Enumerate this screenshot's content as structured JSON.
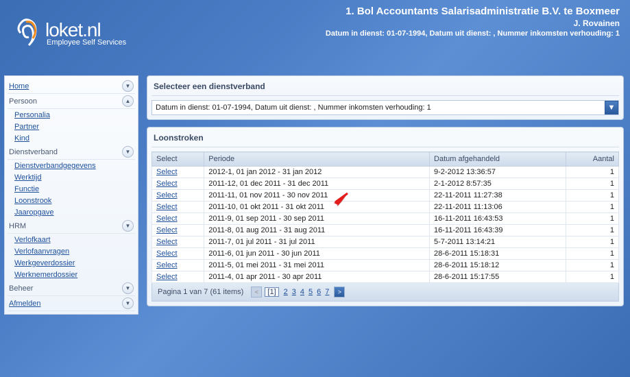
{
  "header": {
    "company": "1. Bol Accountants Salarisadministratie B.V. te Boxmeer",
    "user": "J. Rovainen",
    "detail": "Datum in dienst: 01-07-1994, Datum uit dienst: , Nummer inkomsten verhouding: 1"
  },
  "logo": {
    "name": "loket.nl",
    "tagline": "Employee Self Services"
  },
  "sidebar": {
    "groups": [
      {
        "label": "Home",
        "chev": "down",
        "items": []
      },
      {
        "label": "Persoon",
        "chev": "up",
        "items": [
          "Personalia",
          "Partner",
          "Kind"
        ]
      },
      {
        "label": "Dienstverband",
        "chev": "down",
        "items": [
          "Dienstverbandgegevens",
          "Werktijd",
          "Functie",
          "Loonstrook",
          "Jaaropgave"
        ]
      },
      {
        "label": "HRM",
        "chev": "down",
        "items": [
          "Verlofkaart",
          "Verlofaanvragen",
          "Werkgeverdossier",
          "Werknemerdossier"
        ]
      },
      {
        "label": "Beheer",
        "chev": "down",
        "items": []
      },
      {
        "label": "Afmelden",
        "chev": "down",
        "items": []
      }
    ]
  },
  "panels": {
    "selectTitle": "Selecteer een dienstverband",
    "combo": "Datum in dienst: 01-07-1994, Datum uit dienst: , Nummer inkomsten verhouding: 1",
    "gridTitle": "Loonstroken",
    "columns": [
      "Select",
      "Periode",
      "Datum afgehandeld",
      "Aantal"
    ],
    "selectLabel": "Select",
    "rows": [
      {
        "periode": "2012-1, 01 jan 2012 - 31 jan 2012",
        "datum": "9-2-2012 13:36:57",
        "aantal": "1"
      },
      {
        "periode": "2011-12, 01 dec 2011 - 31 dec 2011",
        "datum": "2-1-2012 8:57:35",
        "aantal": "1"
      },
      {
        "periode": "2011-11, 01 nov 2011 - 30 nov 2011",
        "datum": "22-11-2011 11:27:38",
        "aantal": "1"
      },
      {
        "periode": "2011-10, 01 okt 2011 - 31 okt 2011",
        "datum": "22-11-2011 11:13:06",
        "aantal": "1"
      },
      {
        "periode": "2011-9, 01 sep 2011 - 30 sep 2011",
        "datum": "16-11-2011 16:43:53",
        "aantal": "1"
      },
      {
        "periode": "2011-8, 01 aug 2011 - 31 aug 2011",
        "datum": "16-11-2011 16:43:39",
        "aantal": "1"
      },
      {
        "periode": "2011-7, 01 jul 2011 - 31 jul 2011",
        "datum": "5-7-2011 13:14:21",
        "aantal": "1"
      },
      {
        "periode": "2011-6, 01 jun 2011 - 30 jun 2011",
        "datum": "28-6-2011 15:18:31",
        "aantal": "1"
      },
      {
        "periode": "2011-5, 01 mei 2011 - 31 mei 2011",
        "datum": "28-6-2011 15:18:12",
        "aantal": "1"
      },
      {
        "periode": "2011-4, 01 apr 2011 - 30 apr 2011",
        "datum": "28-6-2011 15:17:55",
        "aantal": "1"
      }
    ],
    "pager": {
      "summary": "Pagina 1 van 7 (61 items)",
      "current": "[1]",
      "pages": [
        "2",
        "3",
        "4",
        "5",
        "6",
        "7"
      ]
    }
  }
}
